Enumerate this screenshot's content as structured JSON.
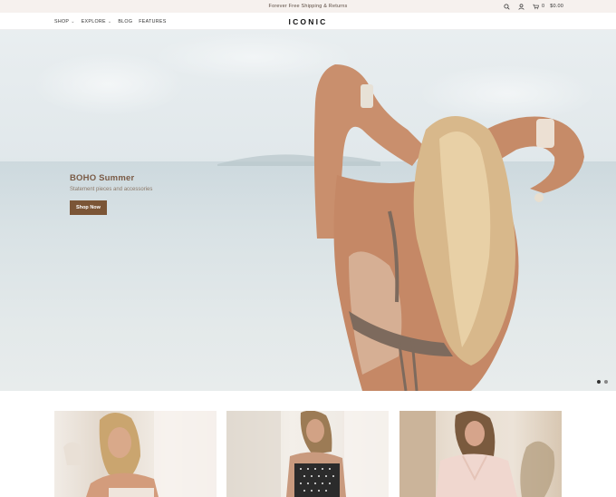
{
  "announcement": {
    "text": "Forever Free Shipping & Returns",
    "cart_count": "0",
    "cart_total": "$0.00",
    "icons": [
      "search-icon",
      "account-icon",
      "cart-icon"
    ]
  },
  "header": {
    "logo": "ICONIC",
    "nav": [
      {
        "label": "SHOP",
        "dropdown": true
      },
      {
        "label": "EXPLORE",
        "dropdown": true
      },
      {
        "label": "BLOG",
        "dropdown": false
      },
      {
        "label": "FEATURES",
        "dropdown": false
      }
    ]
  },
  "hero": {
    "title": "BOHO Summer",
    "subtitle": "Statement pieces and accessories",
    "button": "Shop Now",
    "slide_count": 2,
    "active_slide": 1
  },
  "products": [
    {
      "image": "woman-beige-dress"
    },
    {
      "image": "woman-polka-dot-top"
    },
    {
      "image": "woman-pink-ruffle-dress"
    }
  ],
  "colors": {
    "accent": "#7b5536",
    "announcement_bg": "#f6f1ee",
    "hero_title": "#7a5a45"
  }
}
